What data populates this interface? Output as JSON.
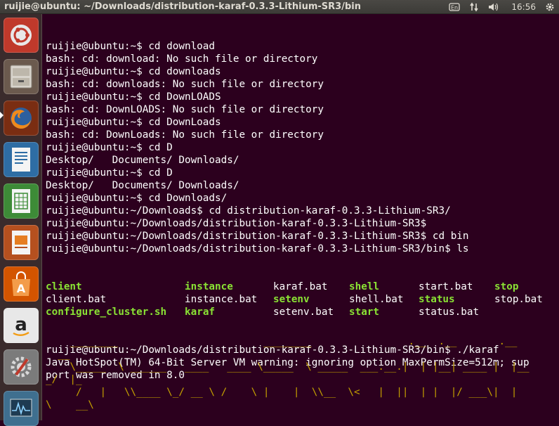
{
  "panel": {
    "window_title": "ruijie@ubuntu: ~/Downloads/distribution-karaf-0.3.3-Lithium-SR3/bin",
    "clock": "16:56"
  },
  "launcher": {
    "items": [
      {
        "name": "ubuntu-dash"
      },
      {
        "name": "files"
      },
      {
        "name": "firefox",
        "active": true
      },
      {
        "name": "libreoffice-writer"
      },
      {
        "name": "libreoffice-calc"
      },
      {
        "name": "libreoffice-impress"
      },
      {
        "name": "ubuntu-software-center"
      },
      {
        "name": "amazon"
      },
      {
        "name": "system-settings"
      },
      {
        "name": "system-monitor"
      }
    ]
  },
  "terminal": {
    "lines": [
      "ruijie@ubuntu:~$ cd download",
      "bash: cd: download: No such file or directory",
      "ruijie@ubuntu:~$ cd downloads",
      "bash: cd: downloads: No such file or directory",
      "ruijie@ubuntu:~$ cd DownLOADS",
      "bash: cd: DownLOADS: No such file or directory",
      "ruijie@ubuntu:~$ cd DownLoads",
      "bash: cd: DownLoads: No such file or directory",
      "ruijie@ubuntu:~$ cd D",
      "Desktop/   Documents/ Downloads/",
      "ruijie@ubuntu:~$ cd D",
      "Desktop/   Documents/ Downloads/",
      "ruijie@ubuntu:~$ cd Downloads/",
      "ruijie@ubuntu:~/Downloads$ cd distribution-karaf-0.3.3-Lithium-SR3/",
      "ruijie@ubuntu:~/Downloads/distribution-karaf-0.3.3-Lithium-SR3$",
      "ruijie@ubuntu:~/Downloads/distribution-karaf-0.3.3-Lithium-SR3$ cd bin",
      "ruijie@ubuntu:~/Downloads/distribution-karaf-0.3.3-Lithium-SR3/bin$ ls"
    ],
    "ls_rows": [
      [
        {
          "text": "client",
          "exec": true
        },
        {
          "text": "instance",
          "exec": true
        },
        {
          "text": "karaf.bat",
          "exec": false
        },
        {
          "text": "shell",
          "exec": true
        },
        {
          "text": "start.bat",
          "exec": false
        },
        {
          "text": "stop",
          "exec": true
        }
      ],
      [
        {
          "text": "client.bat",
          "exec": false
        },
        {
          "text": "instance.bat",
          "exec": false
        },
        {
          "text": "setenv",
          "exec": true
        },
        {
          "text": "shell.bat",
          "exec": false
        },
        {
          "text": "status",
          "exec": true
        },
        {
          "text": "stop.bat",
          "exec": false
        }
      ],
      [
        {
          "text": "configure_cluster.sh",
          "exec": true
        },
        {
          "text": "karaf",
          "exec": true
        },
        {
          "text": "setenv.bat",
          "exec": false
        },
        {
          "text": "start",
          "exec": true
        },
        {
          "text": "status.bat",
          "exec": false
        },
        {
          "text": "",
          "exec": false
        }
      ]
    ],
    "after_lines": [
      "ruijie@ubuntu:~/Downloads/distribution-karaf-0.3.3-Lithium-SR3/bin$ ./karaf",
      "Java HotSpot(TM) 64-Bit Server VM warning: ignoring option MaxPermSize=512m; sup",
      "port was removed in 8.0"
    ],
    "ascii_art": [
      "    ________                        ________                .__  .__       .__",
      "  __",
      "    \\_____  \\ ______   ____   ____ \\_____  \\ _____  ___.__.|  | |__| ____ |  |__",
      "_/  |_",
      "     /   |   \\\\____ \\_/ __ \\ /    \\ |    |  \\\\__  \\<   |  ||  | |  |/ ___\\|  |",
      "\\    __\\"
    ]
  },
  "colors": {
    "terminal_bg": "#2c001e",
    "exec_green": "#8ae234",
    "ascii_yellow": "#c4a000"
  }
}
